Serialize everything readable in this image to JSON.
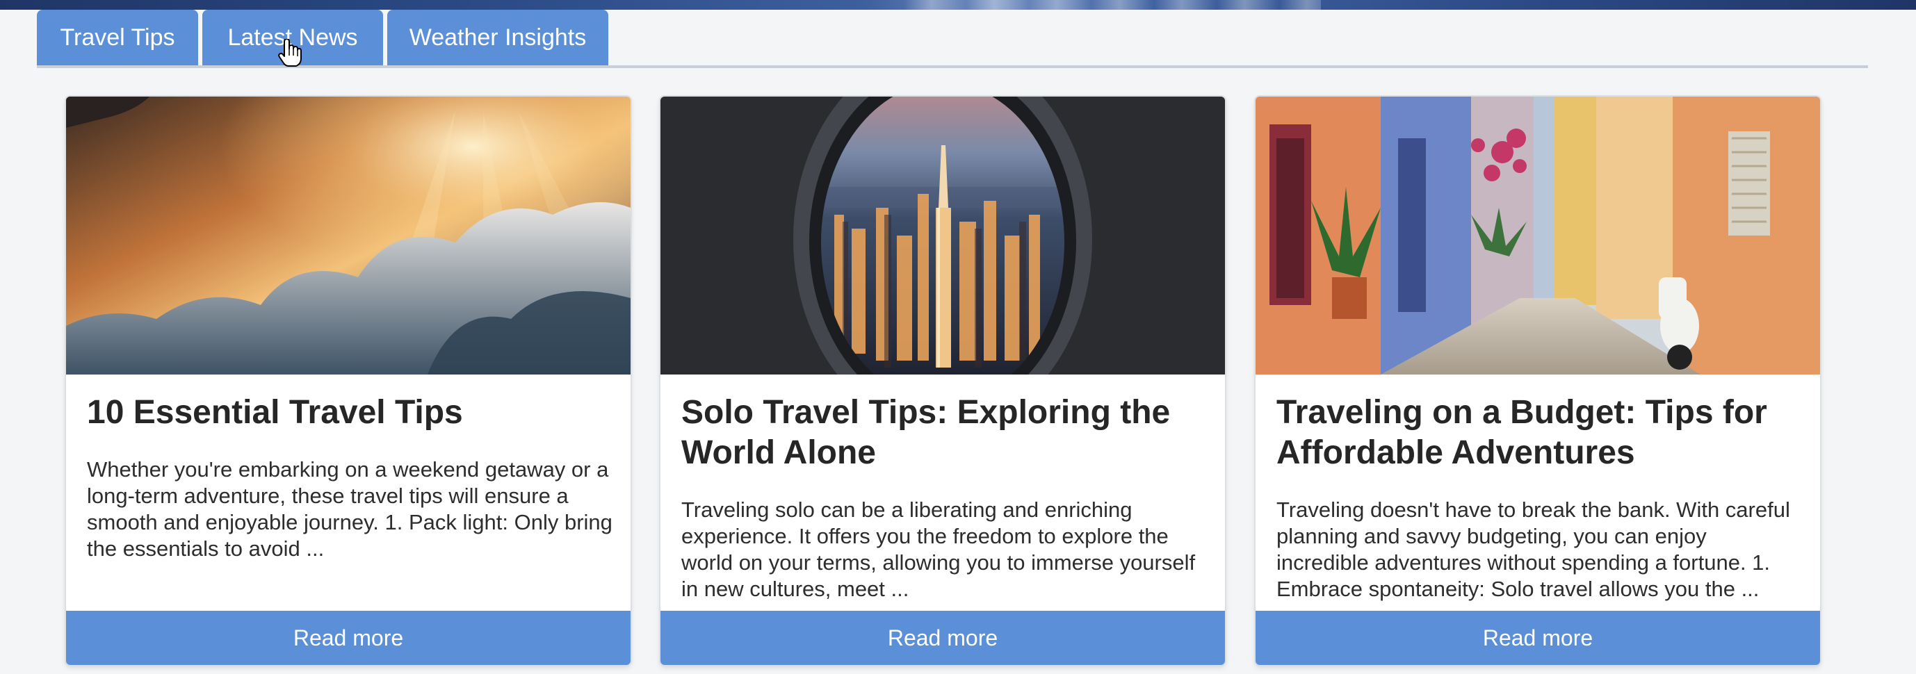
{
  "tabs": [
    {
      "label": "Travel Tips"
    },
    {
      "label": "Latest News"
    },
    {
      "label": "Weather Insights"
    }
  ],
  "cards": [
    {
      "title": "10 Essential Travel Tips",
      "excerpt": "Whether you're embarking on a weekend getaway or a long-term adventure, these travel tips will ensure a smooth and enjoyable journey. 1. Pack light: Only bring the essentials to avoid ...",
      "button_label": "Read more"
    },
    {
      "title": "Solo Travel Tips: Exploring the World Alone",
      "excerpt": "Traveling solo can be a liberating and enriching experience. It offers you the freedom to explore the world on your terms, allowing you to immerse yourself in new cultures, meet ...",
      "button_label": "Read more"
    },
    {
      "title": "Traveling on a Budget: Tips for Affordable Adventures",
      "excerpt": "Traveling doesn't have to break the bank. With careful planning and savvy budgeting, you can enjoy incredible adventures without spending a fortune. 1. Embrace spontaneity: Solo travel allows you the ...",
      "button_label": "Read more"
    }
  ],
  "colors": {
    "accent": "#5b8fd8",
    "page_background": "#f3f5f6",
    "title_text": "#262626"
  },
  "icons": {
    "cursor": "hand-pointer-icon"
  }
}
